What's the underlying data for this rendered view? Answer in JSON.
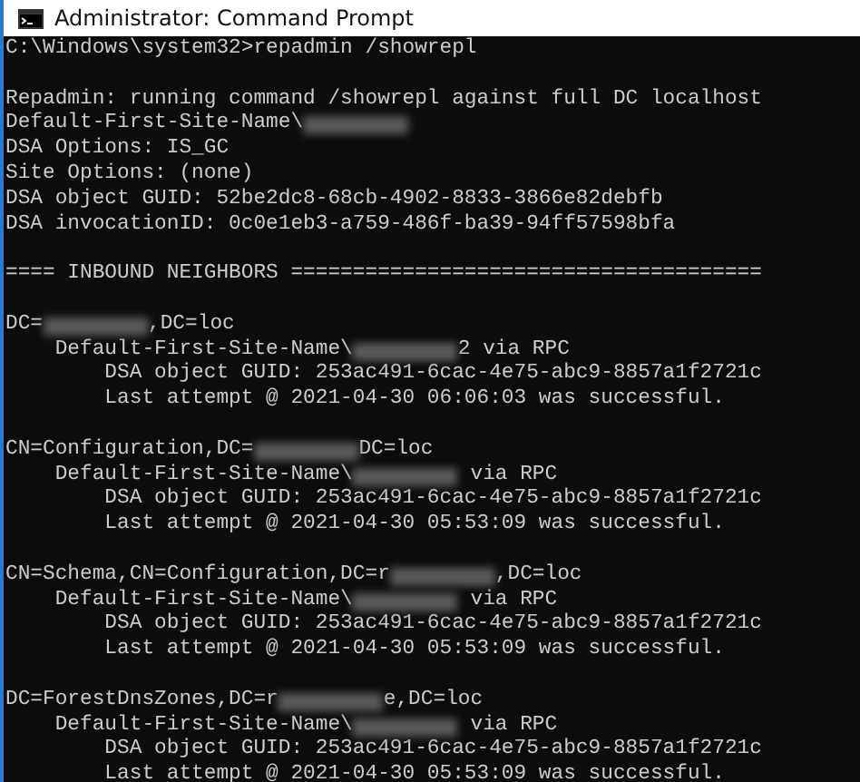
{
  "window": {
    "title": "Administrator: Command Prompt"
  },
  "console": {
    "blocks": [
      [
        [
          {
            "kind": "text",
            "text": "C:\\Windows\\system32>repadmin /showrepl"
          }
        ]
      ],
      [
        [
          {
            "kind": "text",
            "text": "Repadmin: running command /showrepl against full DC localhost"
          }
        ],
        [
          {
            "kind": "text",
            "text": "Default-First-Site-Name\\"
          },
          {
            "kind": "redacted"
          }
        ],
        [
          {
            "kind": "text",
            "text": "DSA Options: IS_GC"
          }
        ],
        [
          {
            "kind": "text",
            "text": "Site Options: (none)"
          }
        ],
        [
          {
            "kind": "text",
            "text": "DSA object GUID: 52be2dc8-68cb-4902-8833-3866e82debfb"
          }
        ],
        [
          {
            "kind": "text",
            "text": "DSA invocationID: 0c0e1eb3-a759-486f-ba39-94ff57598bfa"
          }
        ]
      ],
      [
        [
          {
            "kind": "text",
            "text": "==== INBOUND NEIGHBORS ======================================"
          }
        ]
      ],
      [
        [
          {
            "kind": "text",
            "text": "DC="
          },
          {
            "kind": "redacted"
          },
          {
            "kind": "text",
            "text": ",DC=loc"
          }
        ],
        [
          {
            "kind": "text",
            "text": "    Default-First-Site-Name\\"
          },
          {
            "kind": "redacted"
          },
          {
            "kind": "text",
            "text": "2 via RPC"
          }
        ],
        [
          {
            "kind": "text",
            "text": "        DSA object GUID: 253ac491-6cac-4e75-abc9-8857a1f2721c"
          }
        ],
        [
          {
            "kind": "text",
            "text": "        Last attempt @ 2021-04-30 06:06:03 was successful."
          }
        ]
      ],
      [
        [
          {
            "kind": "text",
            "text": "CN=Configuration,DC="
          },
          {
            "kind": "redacted"
          },
          {
            "kind": "text",
            "text": "DC=loc"
          }
        ],
        [
          {
            "kind": "text",
            "text": "    Default-First-Site-Name\\"
          },
          {
            "kind": "redacted"
          },
          {
            "kind": "text",
            "text": " via RPC"
          }
        ],
        [
          {
            "kind": "text",
            "text": "        DSA object GUID: 253ac491-6cac-4e75-abc9-8857a1f2721c"
          }
        ],
        [
          {
            "kind": "text",
            "text": "        Last attempt @ 2021-04-30 05:53:09 was successful."
          }
        ]
      ],
      [
        [
          {
            "kind": "text",
            "text": "CN=Schema,CN=Configuration,DC=r"
          },
          {
            "kind": "redacted"
          },
          {
            "kind": "text",
            "text": ",DC=loc"
          }
        ],
        [
          {
            "kind": "text",
            "text": "    Default-First-Site-Name\\"
          },
          {
            "kind": "redacted"
          },
          {
            "kind": "text",
            "text": " via RPC"
          }
        ],
        [
          {
            "kind": "text",
            "text": "        DSA object GUID: 253ac491-6cac-4e75-abc9-8857a1f2721c"
          }
        ],
        [
          {
            "kind": "text",
            "text": "        Last attempt @ 2021-04-30 05:53:09 was successful."
          }
        ]
      ],
      [
        [
          {
            "kind": "text",
            "text": "DC=ForestDnsZones,DC=r"
          },
          {
            "kind": "redacted"
          },
          {
            "kind": "text",
            "text": "e,DC=loc"
          }
        ],
        [
          {
            "kind": "text",
            "text": "    Default-First-Site-Name\\"
          },
          {
            "kind": "redacted"
          },
          {
            "kind": "text",
            "text": " via RPC"
          }
        ],
        [
          {
            "kind": "text",
            "text": "        DSA object GUID: 253ac491-6cac-4e75-abc9-8857a1f2721c"
          }
        ],
        [
          {
            "kind": "text",
            "text": "        Last attempt @ 2021-04-30 05:53:09 was successful."
          }
        ]
      ]
    ]
  }
}
